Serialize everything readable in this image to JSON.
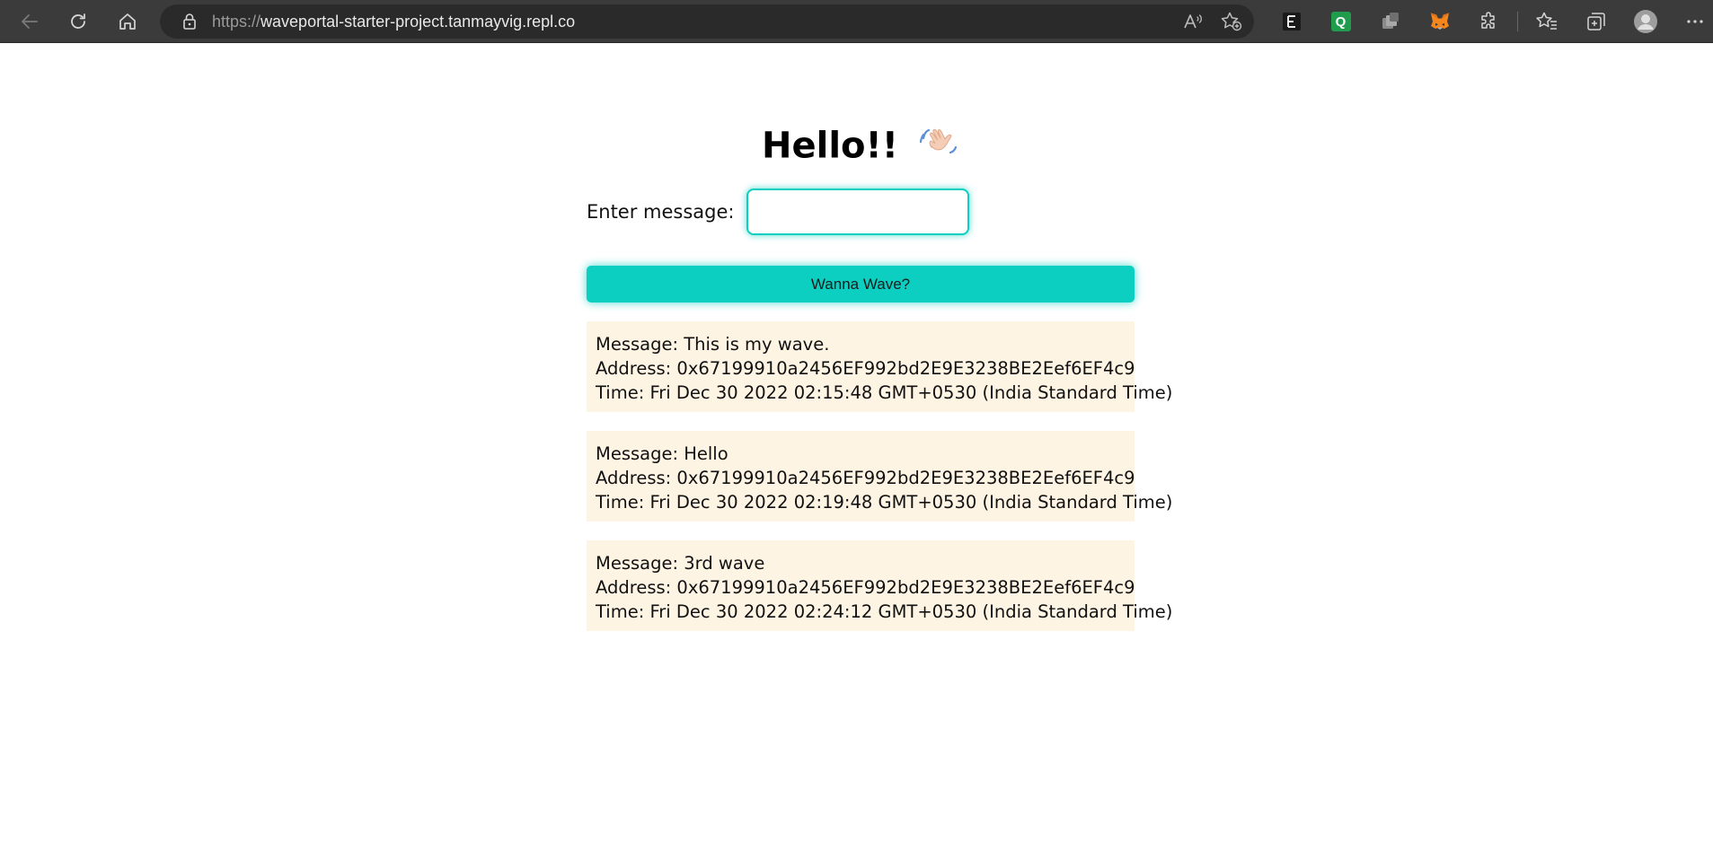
{
  "browser": {
    "url_scheme": "https://",
    "url_host": "waveportal-starter-project.tanmayvig.repl.co",
    "icons": {
      "back": "back-arrow-icon",
      "refresh": "refresh-icon",
      "home": "home-icon",
      "lock": "lock-icon",
      "read_aloud": "read-aloud-icon",
      "add_favorite": "add-favorite-icon",
      "extension_e": "extension-e-icon",
      "extension_q": "extension-q-icon",
      "extension_stack": "extension-stack-icon",
      "metamask": "metamask-fox-icon",
      "extensions": "puzzle-extensions-icon",
      "favorites": "favorites-icon",
      "collections": "collections-icon",
      "profile": "profile-avatar-icon",
      "more": "more-options-icon"
    },
    "q_badge": "Q"
  },
  "page": {
    "title": "Hello!!",
    "input_label": "Enter message:",
    "input_value": "",
    "button_label": "Wanna Wave?",
    "accent_color": "#0ccfc1",
    "card_color": "#fdf4e4"
  },
  "waves": [
    {
      "message": "Message: This is my wave.",
      "address": "Address: 0x67199910a2456EF992bd2E9E3238BE2Eef6EF4c9",
      "time": "Time: Fri Dec 30 2022 02:15:48 GMT+0530 (India Standard Time)"
    },
    {
      "message": "Message: Hello",
      "address": "Address: 0x67199910a2456EF992bd2E9E3238BE2Eef6EF4c9",
      "time": "Time: Fri Dec 30 2022 02:19:48 GMT+0530 (India Standard Time)"
    },
    {
      "message": "Message: 3rd wave",
      "address": "Address: 0x67199910a2456EF992bd2E9E3238BE2Eef6EF4c9",
      "time": "Time: Fri Dec 30 2022 02:24:12 GMT+0530 (India Standard Time)"
    }
  ]
}
